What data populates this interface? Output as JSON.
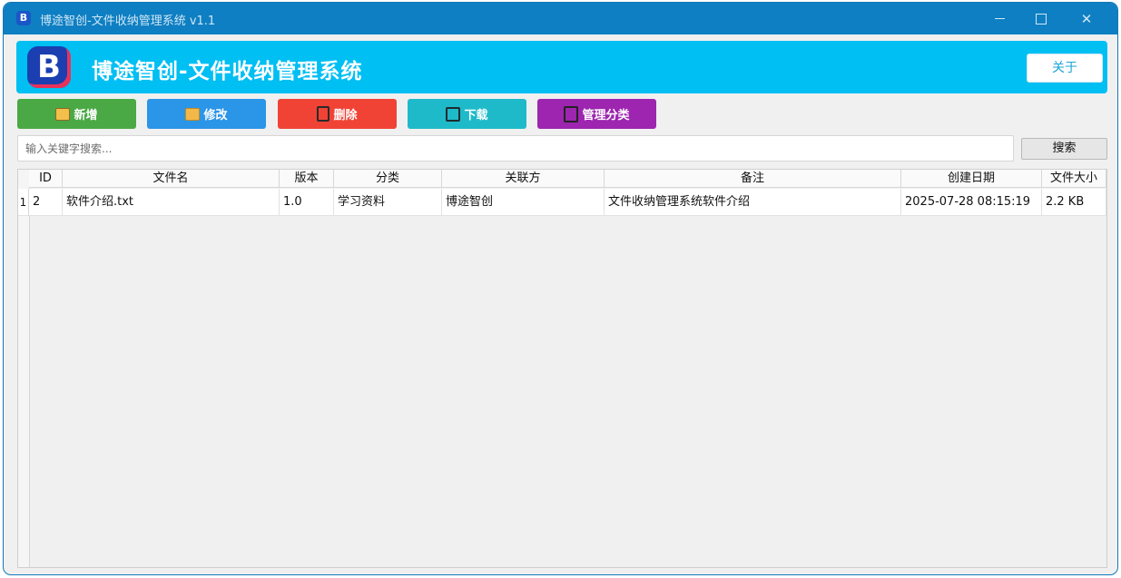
{
  "window": {
    "title": "博途智创-文件收纳管理系统 v1.1",
    "icon_letter": "B"
  },
  "header": {
    "logo_letter": "B",
    "title": "博途智创-文件收纳管理系统",
    "about_label": "关于"
  },
  "toolbar": {
    "add_label": "新增",
    "edit_label": "修改",
    "delete_label": "删除",
    "download_label": "下载",
    "category_label": "管理分类"
  },
  "search": {
    "placeholder": "输入关键字搜索...",
    "value": "",
    "button_label": "搜索"
  },
  "table": {
    "columns": [
      "ID",
      "文件名",
      "版本",
      "分类",
      "关联方",
      "备注",
      "创建日期",
      "文件大小"
    ],
    "rows": [
      {
        "row_number": "1",
        "cells": [
          "2",
          "软件介绍.txt",
          "1.0",
          "学习资料",
          "博途智创",
          "文件收纳管理系统软件介绍",
          "2025-07-28 08:15:19",
          "2.2 KB"
        ]
      }
    ]
  },
  "colors": {
    "titlebar": "#0e7fc2",
    "header": "#00bff3",
    "add": "#4aa945",
    "edit": "#2b95e8",
    "delete": "#f04336",
    "download": "#1fbac9",
    "category": "#9d25b0"
  },
  "icons": {
    "add": "folder-plus-icon",
    "edit": "folder-icon",
    "delete": "trash-icon",
    "download": "save-icon",
    "category": "category-icon"
  }
}
